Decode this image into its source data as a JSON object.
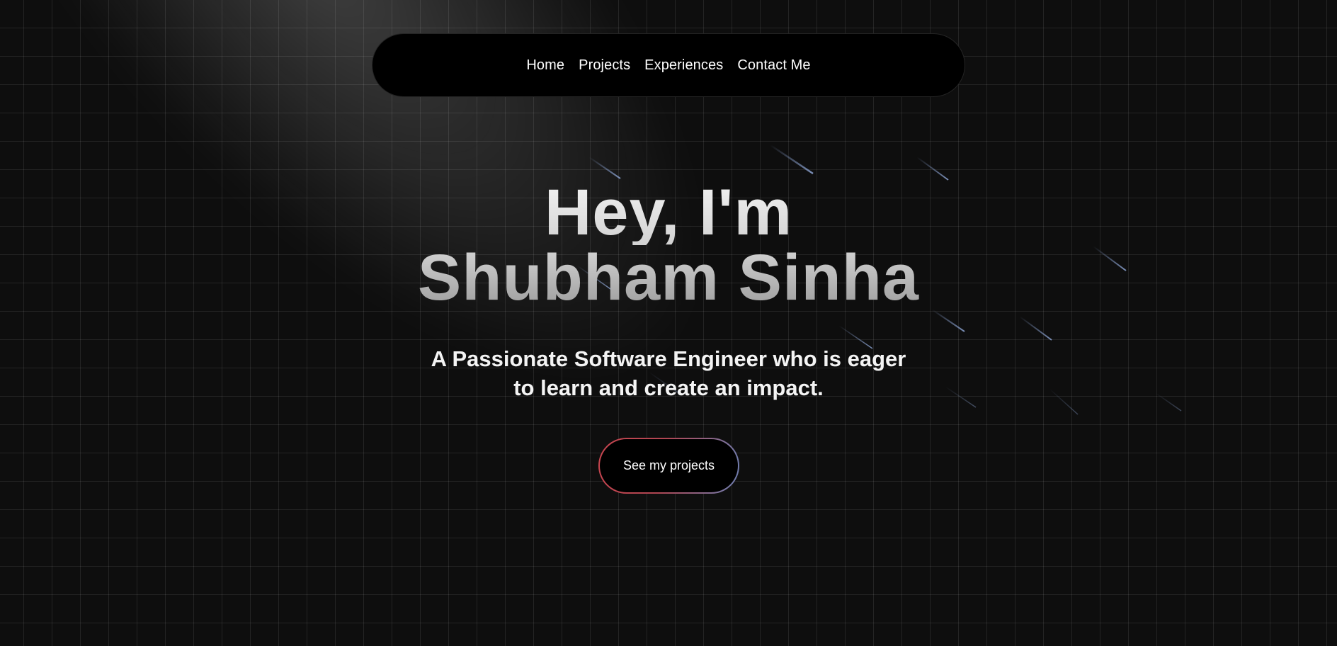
{
  "nav": {
    "items": [
      {
        "label": "Home"
      },
      {
        "label": "Projects"
      },
      {
        "label": "Experiences"
      },
      {
        "label": "Contact Me"
      }
    ]
  },
  "hero": {
    "greeting": "Hey, I'm",
    "name": "Shubham Sinha",
    "tagline_line1": "A Passionate Software Engineer who is eager",
    "tagline_line2": "to learn and create an impact.",
    "cta_label": "See my projects"
  },
  "colors": {
    "background": "#0e0e0e",
    "nav_background": "#000000",
    "cta_border_start": "#c8454f",
    "cta_border_end": "#6d7fb2",
    "meteor": "#8ea6d6"
  }
}
